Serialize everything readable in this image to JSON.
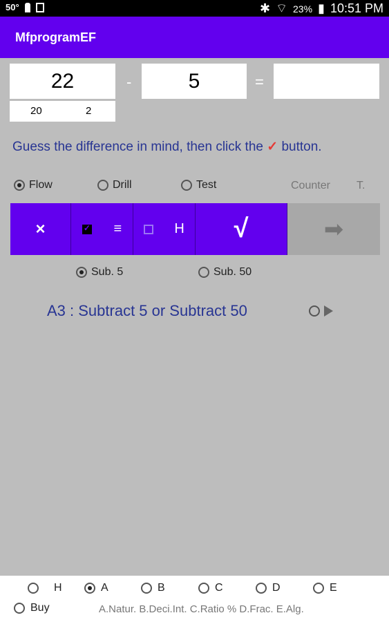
{
  "status": {
    "left_temp": "50°",
    "battery": "23%",
    "time": "10:51 PM"
  },
  "app": {
    "title": "MfprogramEF"
  },
  "problem": {
    "operand1": "22",
    "operator": "-",
    "operand2": "5",
    "equals": "=",
    "answer": "",
    "hint1": "20",
    "hint2": "2"
  },
  "instruction": {
    "before": "Guess the difference in mind, then click the",
    "mark": "✓",
    "after": "button."
  },
  "modes": [
    {
      "label": "Flow",
      "selected": true
    },
    {
      "label": "Drill",
      "selected": false
    },
    {
      "label": "Test",
      "selected": false
    }
  ],
  "counter_label": "Counter",
  "t_label": "T.",
  "toolbar": {
    "clear": "×",
    "list": "≡",
    "h": "H",
    "check": "√",
    "next": "➡"
  },
  "sub": [
    {
      "label": "Sub. 5",
      "selected": true
    },
    {
      "label": "Sub. 50",
      "selected": false
    }
  ],
  "lesson": {
    "text": "A3 :   Subtract 5 or Subtract 50"
  },
  "bottom": {
    "options": [
      {
        "label": "H",
        "selected": false
      },
      {
        "label": "A",
        "selected": true
      },
      {
        "label": "B",
        "selected": false
      },
      {
        "label": "C",
        "selected": false
      },
      {
        "label": "D",
        "selected": false
      },
      {
        "label": "E",
        "selected": false
      }
    ],
    "buy": "Buy",
    "desc": "A.Natur. B.Deci.Int. C.Ratio % D.Frac. E.Alg."
  }
}
